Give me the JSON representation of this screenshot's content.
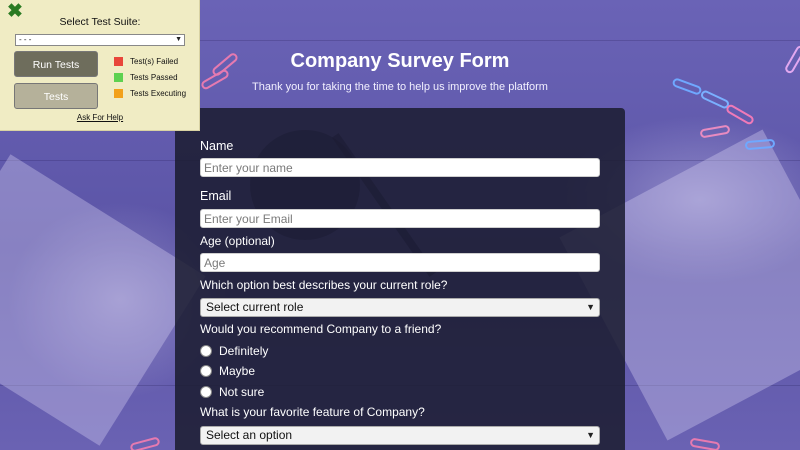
{
  "runner": {
    "suite_label": "Select Test Suite:",
    "suite_value": "- - -",
    "run_button": "Run Tests",
    "tests_button": "Tests",
    "legend": [
      {
        "label": "Test(s) Failed",
        "color": "#e8463a"
      },
      {
        "label": "Tests Passed",
        "color": "#5ed14f"
      },
      {
        "label": "Tests Executing",
        "color": "#f2a11a"
      }
    ],
    "help_link": "Ask For Help",
    "close_icon": "close-icon"
  },
  "header": {
    "title": "Company Survey Form",
    "subtitle": "Thank you for taking the time to help us improve the platform"
  },
  "form": {
    "name_label": "Name",
    "name_placeholder": "Enter your name",
    "email_label": "Email",
    "email_placeholder": "Enter your Email",
    "age_label": "Age (optional)",
    "age_placeholder": "Age",
    "role_question": "Which option best describes your current role?",
    "role_value": "Select current role",
    "recommend_question": "Would you recommend Company to a friend?",
    "recommend_options": [
      "Definitely",
      "Maybe",
      "Not sure"
    ],
    "feature_question": "What is your favorite feature of Company?",
    "feature_value": "Select an option"
  },
  "colors": {
    "panel": "#1b1c30",
    "background": "#5f57a8",
    "runner_bg": "#f0ecc4"
  }
}
